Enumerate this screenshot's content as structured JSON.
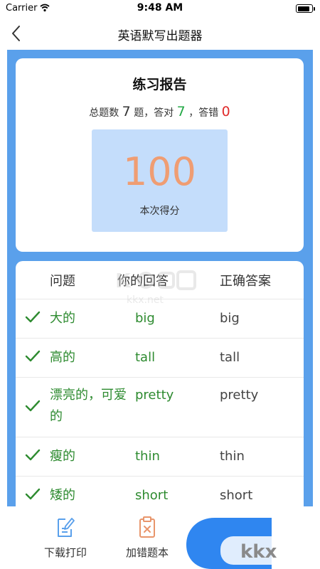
{
  "status_bar": {
    "carrier": "Carrier",
    "time": "9:48 AM"
  },
  "nav": {
    "title": "英语默写出题器"
  },
  "report": {
    "title": "练习报告",
    "summary_prefix": "总题数",
    "total": "7",
    "summary_mid1": "题，答对",
    "correct": "7",
    "summary_mid2": "，答错",
    "wrong": "0",
    "score": "100",
    "score_label": "本次得分"
  },
  "table": {
    "headers": {
      "question": "问题",
      "your_answer": "你的回答",
      "correct_answer": "正确答案"
    },
    "rows": [
      {
        "question": "大的",
        "your_answer": "big",
        "correct_answer": "big",
        "status_icon": "check-icon"
      },
      {
        "question": "高的",
        "your_answer": "tall",
        "correct_answer": "tall",
        "status_icon": "check-icon"
      },
      {
        "question": "漂亮的，可爱的",
        "your_answer": "pretty",
        "correct_answer": "pretty",
        "status_icon": "check-icon"
      },
      {
        "question": "瘦的",
        "your_answer": "thin",
        "correct_answer": "thin",
        "status_icon": "check-icon"
      },
      {
        "question": "矮的",
        "your_answer": "short",
        "correct_answer": "short",
        "status_icon": "check-icon"
      }
    ]
  },
  "toolbar": {
    "download_label": "下载打印",
    "add_wrong_label": "加错题本"
  },
  "colors": {
    "accent_blue": "#5aa0eb",
    "correct_green": "#2e8b30",
    "wrong_red": "#e02b2b",
    "score_orange": "#ef9d73"
  },
  "watermark": {
    "text": "kkx.net"
  }
}
